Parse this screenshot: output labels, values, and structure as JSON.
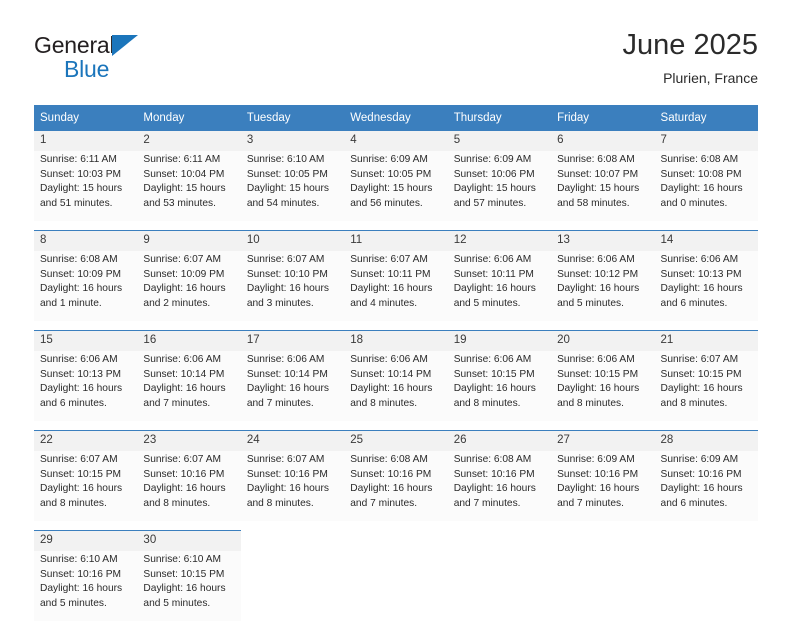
{
  "logo": {
    "text_top": "General",
    "text_bottom": "Blue",
    "triangle_color": "#1b75bb",
    "blue_color": "#1b75bb",
    "dark_color": "#231f20"
  },
  "header": {
    "title": "June 2025",
    "subtitle": "Plurien, France"
  },
  "colors": {
    "header_bg": "#3b7fbe",
    "header_text": "#ffffff",
    "daynum_bg": "#f2f2f2",
    "cell_bg": "#fbfbfb",
    "separator": "#3b7fbe"
  },
  "weekdays": [
    "Sunday",
    "Monday",
    "Tuesday",
    "Wednesday",
    "Thursday",
    "Friday",
    "Saturday"
  ],
  "weeks": [
    [
      {
        "day": "1",
        "sunrise": "Sunrise: 6:11 AM",
        "sunset": "Sunset: 10:03 PM",
        "daylight1": "Daylight: 15 hours",
        "daylight2": "and 51 minutes."
      },
      {
        "day": "2",
        "sunrise": "Sunrise: 6:11 AM",
        "sunset": "Sunset: 10:04 PM",
        "daylight1": "Daylight: 15 hours",
        "daylight2": "and 53 minutes."
      },
      {
        "day": "3",
        "sunrise": "Sunrise: 6:10 AM",
        "sunset": "Sunset: 10:05 PM",
        "daylight1": "Daylight: 15 hours",
        "daylight2": "and 54 minutes."
      },
      {
        "day": "4",
        "sunrise": "Sunrise: 6:09 AM",
        "sunset": "Sunset: 10:05 PM",
        "daylight1": "Daylight: 15 hours",
        "daylight2": "and 56 minutes."
      },
      {
        "day": "5",
        "sunrise": "Sunrise: 6:09 AM",
        "sunset": "Sunset: 10:06 PM",
        "daylight1": "Daylight: 15 hours",
        "daylight2": "and 57 minutes."
      },
      {
        "day": "6",
        "sunrise": "Sunrise: 6:08 AM",
        "sunset": "Sunset: 10:07 PM",
        "daylight1": "Daylight: 15 hours",
        "daylight2": "and 58 minutes."
      },
      {
        "day": "7",
        "sunrise": "Sunrise: 6:08 AM",
        "sunset": "Sunset: 10:08 PM",
        "daylight1": "Daylight: 16 hours",
        "daylight2": "and 0 minutes."
      }
    ],
    [
      {
        "day": "8",
        "sunrise": "Sunrise: 6:08 AM",
        "sunset": "Sunset: 10:09 PM",
        "daylight1": "Daylight: 16 hours",
        "daylight2": "and 1 minute."
      },
      {
        "day": "9",
        "sunrise": "Sunrise: 6:07 AM",
        "sunset": "Sunset: 10:09 PM",
        "daylight1": "Daylight: 16 hours",
        "daylight2": "and 2 minutes."
      },
      {
        "day": "10",
        "sunrise": "Sunrise: 6:07 AM",
        "sunset": "Sunset: 10:10 PM",
        "daylight1": "Daylight: 16 hours",
        "daylight2": "and 3 minutes."
      },
      {
        "day": "11",
        "sunrise": "Sunrise: 6:07 AM",
        "sunset": "Sunset: 10:11 PM",
        "daylight1": "Daylight: 16 hours",
        "daylight2": "and 4 minutes."
      },
      {
        "day": "12",
        "sunrise": "Sunrise: 6:06 AM",
        "sunset": "Sunset: 10:11 PM",
        "daylight1": "Daylight: 16 hours",
        "daylight2": "and 5 minutes."
      },
      {
        "day": "13",
        "sunrise": "Sunrise: 6:06 AM",
        "sunset": "Sunset: 10:12 PM",
        "daylight1": "Daylight: 16 hours",
        "daylight2": "and 5 minutes."
      },
      {
        "day": "14",
        "sunrise": "Sunrise: 6:06 AM",
        "sunset": "Sunset: 10:13 PM",
        "daylight1": "Daylight: 16 hours",
        "daylight2": "and 6 minutes."
      }
    ],
    [
      {
        "day": "15",
        "sunrise": "Sunrise: 6:06 AM",
        "sunset": "Sunset: 10:13 PM",
        "daylight1": "Daylight: 16 hours",
        "daylight2": "and 6 minutes."
      },
      {
        "day": "16",
        "sunrise": "Sunrise: 6:06 AM",
        "sunset": "Sunset: 10:14 PM",
        "daylight1": "Daylight: 16 hours",
        "daylight2": "and 7 minutes."
      },
      {
        "day": "17",
        "sunrise": "Sunrise: 6:06 AM",
        "sunset": "Sunset: 10:14 PM",
        "daylight1": "Daylight: 16 hours",
        "daylight2": "and 7 minutes."
      },
      {
        "day": "18",
        "sunrise": "Sunrise: 6:06 AM",
        "sunset": "Sunset: 10:14 PM",
        "daylight1": "Daylight: 16 hours",
        "daylight2": "and 8 minutes."
      },
      {
        "day": "19",
        "sunrise": "Sunrise: 6:06 AM",
        "sunset": "Sunset: 10:15 PM",
        "daylight1": "Daylight: 16 hours",
        "daylight2": "and 8 minutes."
      },
      {
        "day": "20",
        "sunrise": "Sunrise: 6:06 AM",
        "sunset": "Sunset: 10:15 PM",
        "daylight1": "Daylight: 16 hours",
        "daylight2": "and 8 minutes."
      },
      {
        "day": "21",
        "sunrise": "Sunrise: 6:07 AM",
        "sunset": "Sunset: 10:15 PM",
        "daylight1": "Daylight: 16 hours",
        "daylight2": "and 8 minutes."
      }
    ],
    [
      {
        "day": "22",
        "sunrise": "Sunrise: 6:07 AM",
        "sunset": "Sunset: 10:15 PM",
        "daylight1": "Daylight: 16 hours",
        "daylight2": "and 8 minutes."
      },
      {
        "day": "23",
        "sunrise": "Sunrise: 6:07 AM",
        "sunset": "Sunset: 10:16 PM",
        "daylight1": "Daylight: 16 hours",
        "daylight2": "and 8 minutes."
      },
      {
        "day": "24",
        "sunrise": "Sunrise: 6:07 AM",
        "sunset": "Sunset: 10:16 PM",
        "daylight1": "Daylight: 16 hours",
        "daylight2": "and 8 minutes."
      },
      {
        "day": "25",
        "sunrise": "Sunrise: 6:08 AM",
        "sunset": "Sunset: 10:16 PM",
        "daylight1": "Daylight: 16 hours",
        "daylight2": "and 7 minutes."
      },
      {
        "day": "26",
        "sunrise": "Sunrise: 6:08 AM",
        "sunset": "Sunset: 10:16 PM",
        "daylight1": "Daylight: 16 hours",
        "daylight2": "and 7 minutes."
      },
      {
        "day": "27",
        "sunrise": "Sunrise: 6:09 AM",
        "sunset": "Sunset: 10:16 PM",
        "daylight1": "Daylight: 16 hours",
        "daylight2": "and 7 minutes."
      },
      {
        "day": "28",
        "sunrise": "Sunrise: 6:09 AM",
        "sunset": "Sunset: 10:16 PM",
        "daylight1": "Daylight: 16 hours",
        "daylight2": "and 6 minutes."
      }
    ],
    [
      {
        "day": "29",
        "sunrise": "Sunrise: 6:10 AM",
        "sunset": "Sunset: 10:16 PM",
        "daylight1": "Daylight: 16 hours",
        "daylight2": "and 5 minutes."
      },
      {
        "day": "30",
        "sunrise": "Sunrise: 6:10 AM",
        "sunset": "Sunset: 10:15 PM",
        "daylight1": "Daylight: 16 hours",
        "daylight2": "and 5 minutes."
      },
      {
        "day": "",
        "sunrise": "",
        "sunset": "",
        "daylight1": "",
        "daylight2": ""
      },
      {
        "day": "",
        "sunrise": "",
        "sunset": "",
        "daylight1": "",
        "daylight2": ""
      },
      {
        "day": "",
        "sunrise": "",
        "sunset": "",
        "daylight1": "",
        "daylight2": ""
      },
      {
        "day": "",
        "sunrise": "",
        "sunset": "",
        "daylight1": "",
        "daylight2": ""
      },
      {
        "day": "",
        "sunrise": "",
        "sunset": "",
        "daylight1": "",
        "daylight2": ""
      }
    ]
  ]
}
